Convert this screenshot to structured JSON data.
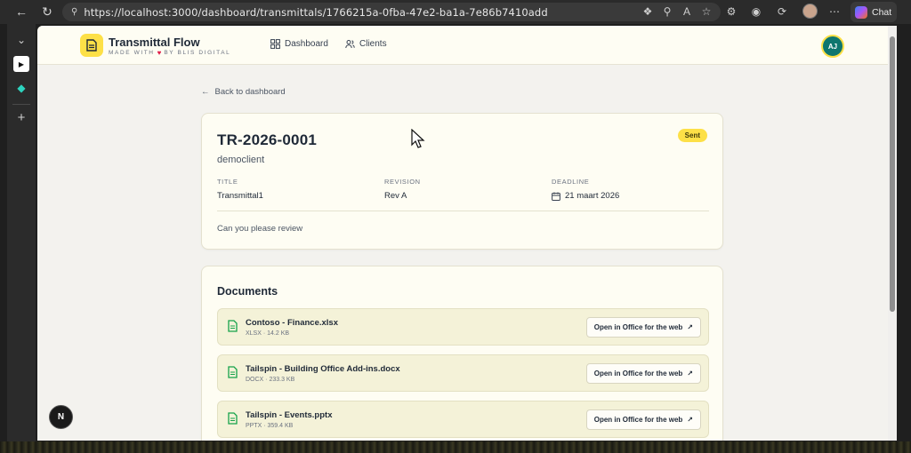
{
  "browser": {
    "url": "https://localhost:3000/dashboard/transmittals/1766215a-0fba-47e2-ba1a-7e86b7410add",
    "chat_label": "Chat"
  },
  "header": {
    "brand_name": "Transmittal Flow",
    "brand_sub_pre": "MADE WITH",
    "brand_sub_post": "BY BLIS DIGITAL",
    "nav": [
      {
        "label": "Dashboard",
        "icon": "grid-icon"
      },
      {
        "label": "Clients",
        "icon": "users-icon"
      }
    ],
    "avatar_initials": "AJ"
  },
  "back_link": "Back to dashboard",
  "transmittal": {
    "id": "TR-2026-0001",
    "client": "democlient",
    "status": "Sent",
    "status_color": "#fde047",
    "fields": {
      "title_label": "TITLE",
      "title_value": "Transmittal1",
      "revision_label": "REVISION",
      "revision_value": "Rev A",
      "deadline_label": "DEADLINE",
      "deadline_value": "21 maart 2026"
    },
    "message": "Can you please review"
  },
  "documents": {
    "title": "Documents",
    "open_label": "Open in Office for the web",
    "items": [
      {
        "name": "Contoso - Finance.xlsx",
        "meta": "XLSX · 14.2 KB"
      },
      {
        "name": "Tailspin - Building Office Add-ins.docx",
        "meta": "DOCX · 233.3 KB"
      },
      {
        "name": "Tailspin - Events.pptx",
        "meta": "PPTX · 359.4 KB"
      }
    ]
  },
  "dev_badge": "N",
  "colors": {
    "accent": "#fde047",
    "doc_icon": "#16a34a",
    "avatar_bg": "#0f766e"
  }
}
